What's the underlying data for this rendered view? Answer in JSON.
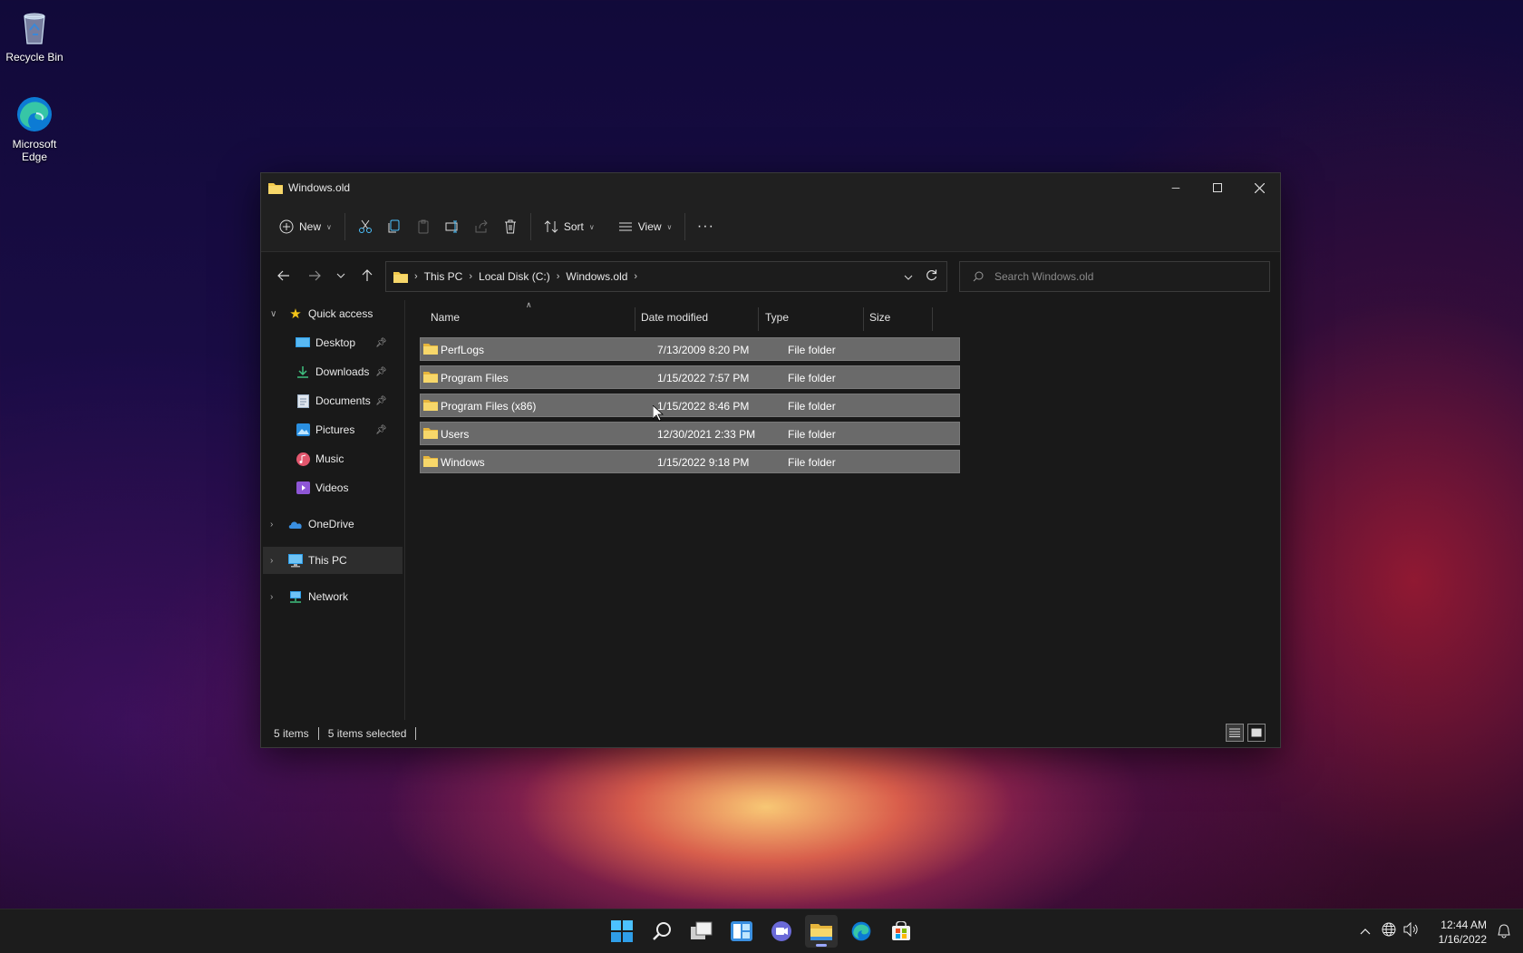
{
  "desktop": {
    "icons": [
      {
        "label": "Recycle Bin",
        "icon": "recycle-bin-icon"
      },
      {
        "label": "Microsoft Edge",
        "icon": "edge-icon"
      }
    ]
  },
  "window": {
    "title": "Windows.old",
    "controls": {
      "minimize": "minimize-icon",
      "maximize": "maximize-icon",
      "close": "close-icon"
    }
  },
  "toolbar": {
    "new_label": "New",
    "sort_label": "Sort",
    "view_label": "View",
    "icons": [
      "new-icon",
      "cut-icon",
      "copy-icon",
      "paste-icon",
      "rename-icon",
      "share-icon",
      "delete-icon",
      "sort-icon",
      "view-icon",
      "more-icon"
    ]
  },
  "address": {
    "crumbs": [
      "This PC",
      "Local Disk (C:)",
      "Windows.old"
    ]
  },
  "search": {
    "placeholder": "Search Windows.old"
  },
  "nav": {
    "quick_access": "Quick access",
    "items": [
      {
        "label": "Desktop",
        "icon": "desktop-icon",
        "pinned": true
      },
      {
        "label": "Downloads",
        "icon": "downloads-icon",
        "pinned": true
      },
      {
        "label": "Documents",
        "icon": "documents-icon",
        "pinned": true
      },
      {
        "label": "Pictures",
        "icon": "pictures-icon",
        "pinned": true
      },
      {
        "label": "Music",
        "icon": "music-icon",
        "pinned": false
      },
      {
        "label": "Videos",
        "icon": "videos-icon",
        "pinned": false
      }
    ],
    "onedrive": "OneDrive",
    "this_pc": "This PC",
    "network": "Network"
  },
  "columns": {
    "name": "Name",
    "date": "Date modified",
    "type": "Type",
    "size": "Size"
  },
  "files": [
    {
      "name": "PerfLogs",
      "date": "7/13/2009 8:20 PM",
      "type": "File folder",
      "size": ""
    },
    {
      "name": "Program Files",
      "date": "1/15/2022 7:57 PM",
      "type": "File folder",
      "size": ""
    },
    {
      "name": "Program Files (x86)",
      "date": "1/15/2022 8:46 PM",
      "type": "File folder",
      "size": ""
    },
    {
      "name": "Users",
      "date": "12/30/2021 2:33 PM",
      "type": "File folder",
      "size": ""
    },
    {
      "name": "Windows",
      "date": "1/15/2022 9:18 PM",
      "type": "File folder",
      "size": ""
    }
  ],
  "status": {
    "items": "5 items",
    "selected": "5 items selected"
  },
  "taskbar": {
    "apps": [
      "start-icon",
      "search-icon",
      "task-view-icon",
      "widgets-icon",
      "chat-icon",
      "file-explorer-icon",
      "edge-icon",
      "store-icon"
    ],
    "time": "12:44 AM",
    "date": "1/16/2022"
  },
  "colors": {
    "folder": "#f2c94c",
    "selection": "#6a6a6a",
    "accent": "#4cc2ff"
  }
}
